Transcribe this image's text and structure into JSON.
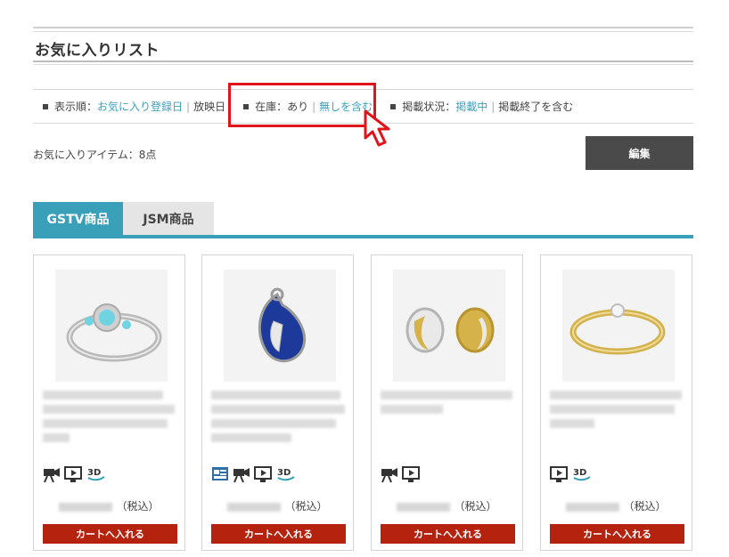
{
  "page": {
    "title": "お気に入りリスト"
  },
  "filters": {
    "sort": {
      "label": "表示順：",
      "options": [
        "お気に入り登録日",
        "放映日"
      ]
    },
    "stock": {
      "label": "在庫：",
      "options": [
        "あり",
        "無しを含む"
      ]
    },
    "listing": {
      "label": "掲載状況：",
      "options": [
        "掲載中",
        "掲載終了を含む"
      ]
    }
  },
  "summary": {
    "count_text": "お気に入りアイテム：8点"
  },
  "edit_button": "編集",
  "tabs": [
    {
      "label": "GSTV商品",
      "active": true
    },
    {
      "label": "JSM商品",
      "active": false
    }
  ],
  "products": [
    {
      "image": "aquamarine-halo-ring",
      "icons": [
        "video-camera-icon",
        "play-icon",
        "3d-icon"
      ],
      "price_suffix": "（税込）",
      "cart_label": "カートへ入れる"
    },
    {
      "image": "sapphire-pendant",
      "icons": [
        "gallery-icon",
        "video-camera-icon",
        "play-icon",
        "3d-icon"
      ],
      "price_suffix": "（税込）",
      "cart_label": "カートへ入れる"
    },
    {
      "image": "two-tone-earrings",
      "icons": [
        "video-camera-icon",
        "play-icon"
      ],
      "price_suffix": "（税込）",
      "cart_label": "カートへ入れる"
    },
    {
      "image": "gold-diamond-ring",
      "icons": [
        "play-icon",
        "3d-icon"
      ],
      "price_suffix": "（税込）",
      "cart_label": "カートへ入れる"
    }
  ],
  "colors": {
    "accent": "#3aa0ba",
    "cart": "#b5220e",
    "highlight": "#e0141b",
    "edit": "#4a4a4a"
  }
}
